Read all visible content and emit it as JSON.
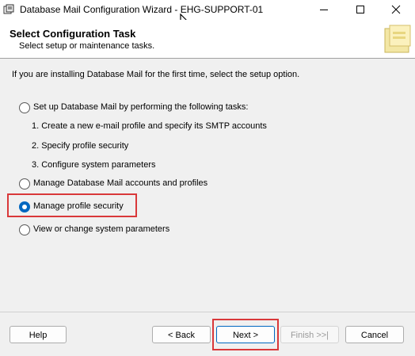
{
  "window": {
    "title": "Database Mail Configuration Wizard - EHG-SUPPORT-01"
  },
  "header": {
    "title": "Select Configuration Task",
    "subtitle": "Select setup or maintenance tasks."
  },
  "intro": "If you are installing Database Mail for the first time, select the setup option.",
  "options": {
    "setup": {
      "label": "Set up Database Mail by performing the following tasks:",
      "checked": false
    },
    "steps": [
      "1. Create a new e-mail profile and specify its SMTP accounts",
      "2. Specify profile security",
      "3. Configure system parameters"
    ],
    "manage_accounts": {
      "label": "Manage Database Mail accounts and profiles",
      "checked": false
    },
    "manage_security": {
      "label": "Manage profile security",
      "checked": true
    },
    "system_params": {
      "label": "View or change system parameters",
      "checked": false
    }
  },
  "buttons": {
    "help": "Help",
    "back": "< Back",
    "next": "Next >",
    "finish": "Finish >>|",
    "cancel": "Cancel"
  },
  "colors": {
    "highlight": "#d9383a",
    "accent": "#0067c0"
  }
}
